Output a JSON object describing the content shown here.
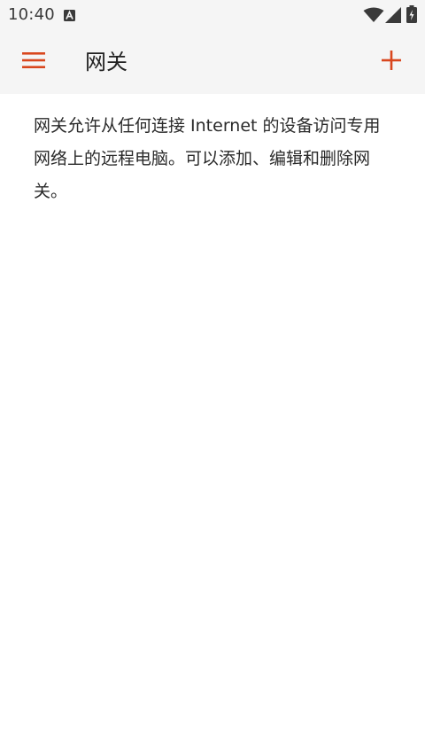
{
  "status_bar": {
    "time": "10:40",
    "icons": [
      "a-notification-icon",
      "wifi-icon",
      "signal-icon",
      "battery-icon"
    ]
  },
  "app_bar": {
    "title": "网关",
    "menu_icon": "hamburger-menu-icon",
    "add_icon": "plus-icon",
    "accent_color": "#d9471e"
  },
  "main": {
    "description": "网关允许从任何连接 Internet 的设备访问专用网络上的远程电脑。可以添加、编辑和删除网关。"
  }
}
